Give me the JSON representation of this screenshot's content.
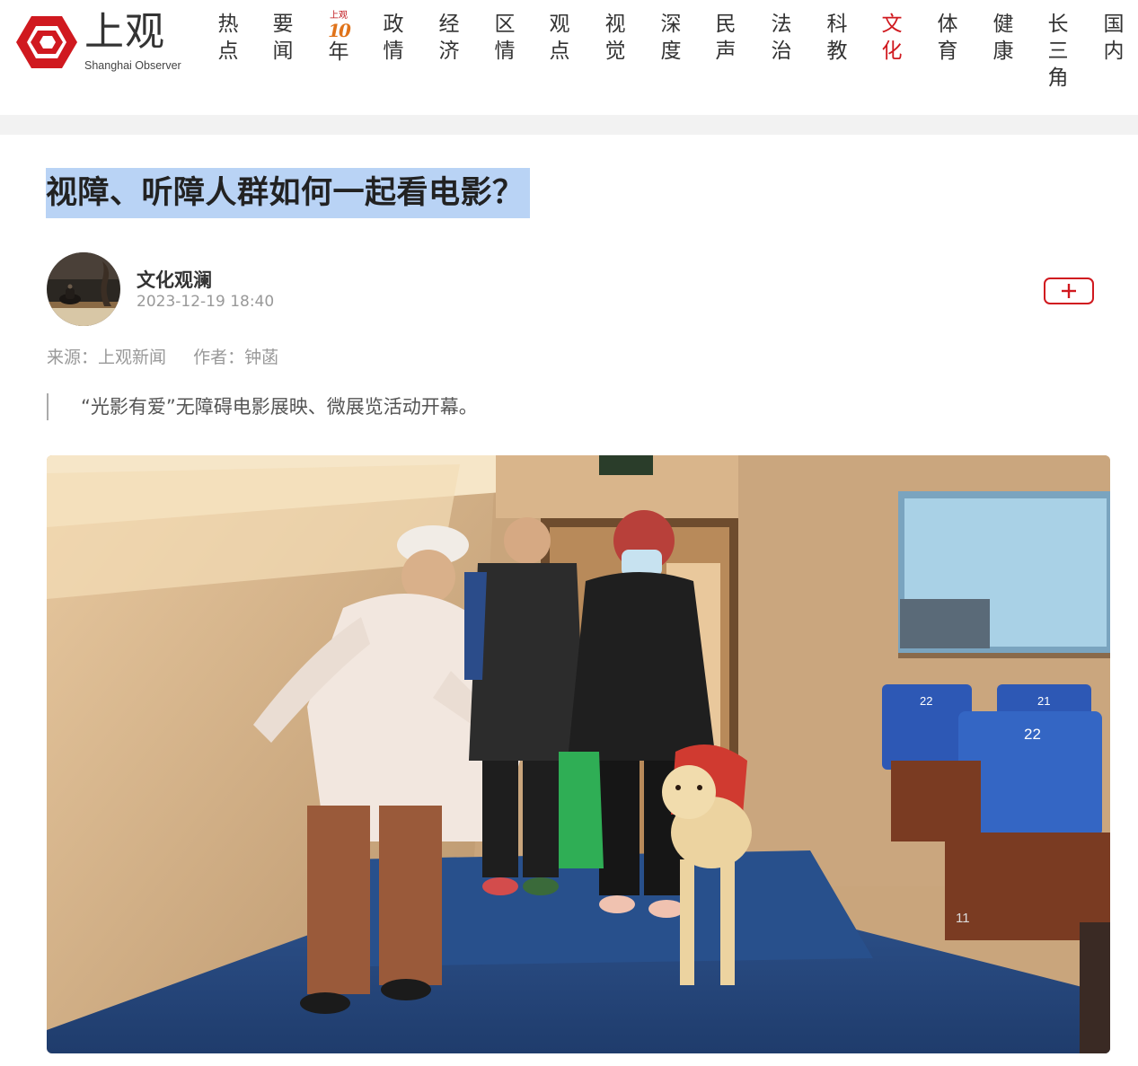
{
  "brand": {
    "name_cn": "上观",
    "name_en": "Shanghai Observer",
    "color": "#d0191f"
  },
  "nav": {
    "items": [
      {
        "label": "热点"
      },
      {
        "label": "要闻"
      },
      {
        "label_top": "上观",
        "label_num": "10",
        "label": "年"
      },
      {
        "label": "政情"
      },
      {
        "label": "经济"
      },
      {
        "label": "区情"
      },
      {
        "label": "观点"
      },
      {
        "label": "视觉"
      },
      {
        "label": "深度"
      },
      {
        "label": "民声"
      },
      {
        "label": "法治"
      },
      {
        "label": "科教"
      },
      {
        "label": "文化",
        "active": true
      },
      {
        "label": "体育"
      },
      {
        "label": "健康"
      },
      {
        "label": "长三角"
      },
      {
        "label": "国内"
      }
    ],
    "active_color": "#d0191f"
  },
  "article": {
    "title": "视障、听障人群如何一起看电影？",
    "author": "文化观澜",
    "published": "2023-12-19 18:40",
    "source": "来源：上观新闻",
    "writer": "作者：钟菡",
    "summary": "“光影有爱”无障碍电影展映、微展览活动开幕。",
    "follow_icon": "plus-icon",
    "seat_labels": [
      "22",
      "21",
      "22",
      "11"
    ]
  }
}
